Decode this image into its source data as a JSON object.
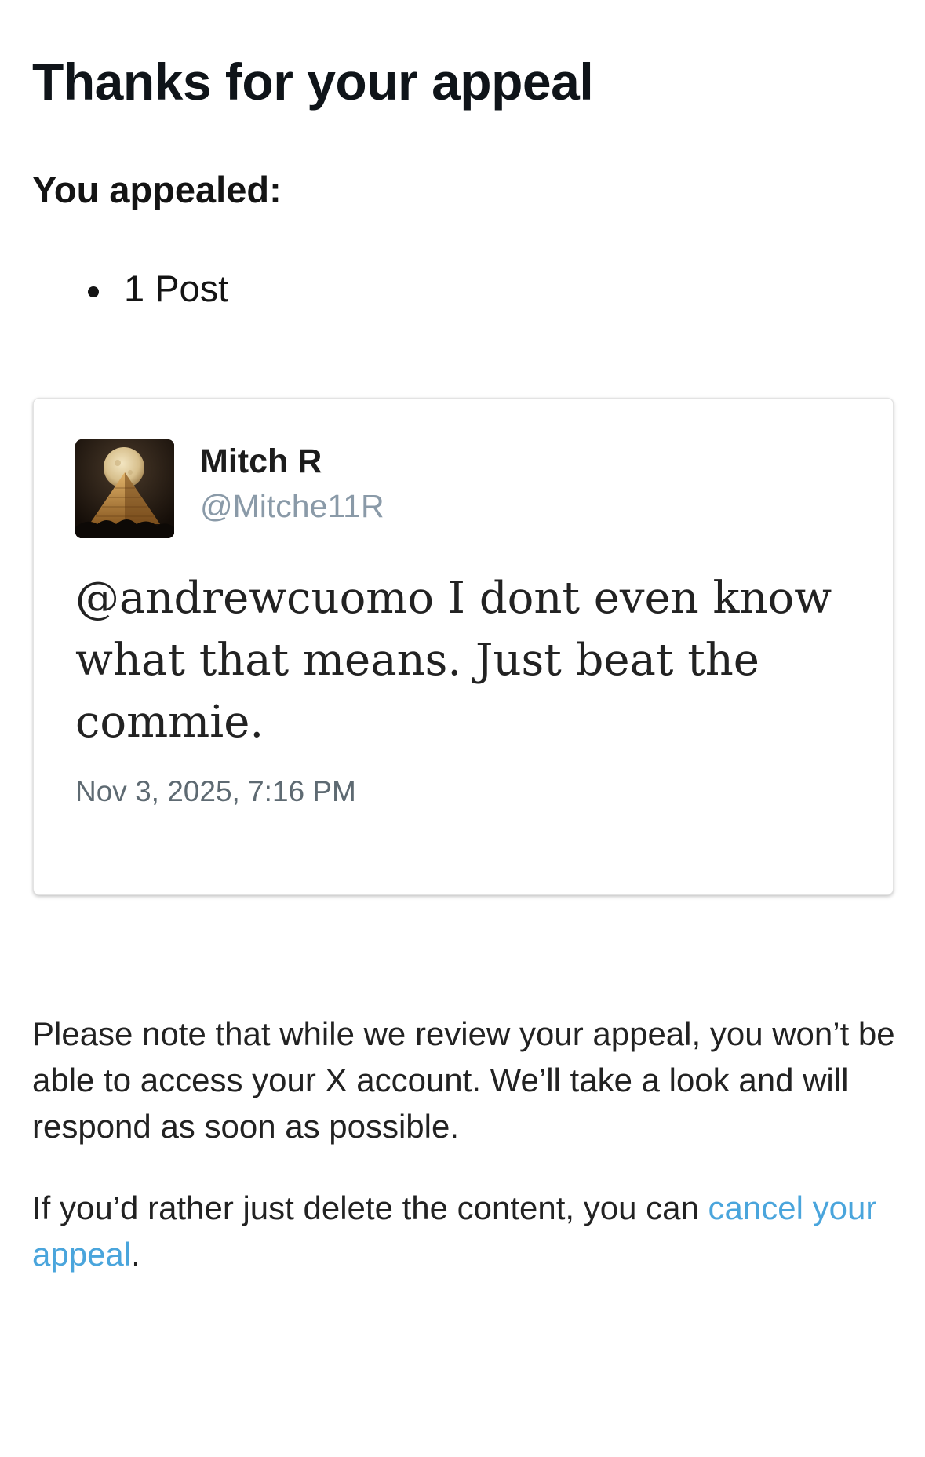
{
  "page": {
    "title": "Thanks for your appeal",
    "subtitle": "You appealed:",
    "appealed_items": [
      "1 Post"
    ]
  },
  "tweet": {
    "name": "Mitch R",
    "handle": "@Mitche11R",
    "text": "@andrewcuomo I dont even know what that means. Just beat the commie.",
    "timestamp": "Nov 3, 2025, 7:16 PM",
    "avatar_icon": "moon-over-pyramid-avatar"
  },
  "notice": {
    "paragraph": "Please note that while we review your appeal, you won’t be able to access your X account. We’ll take a look and will respond as soon as possible.",
    "cancel_prefix": "If you’d rather just delete the content, you can ",
    "cancel_link": "cancel your appeal",
    "cancel_suffix": "."
  },
  "colors": {
    "link": "#4aa5dc",
    "handle": "#8a9aa8",
    "text": "#141414"
  }
}
